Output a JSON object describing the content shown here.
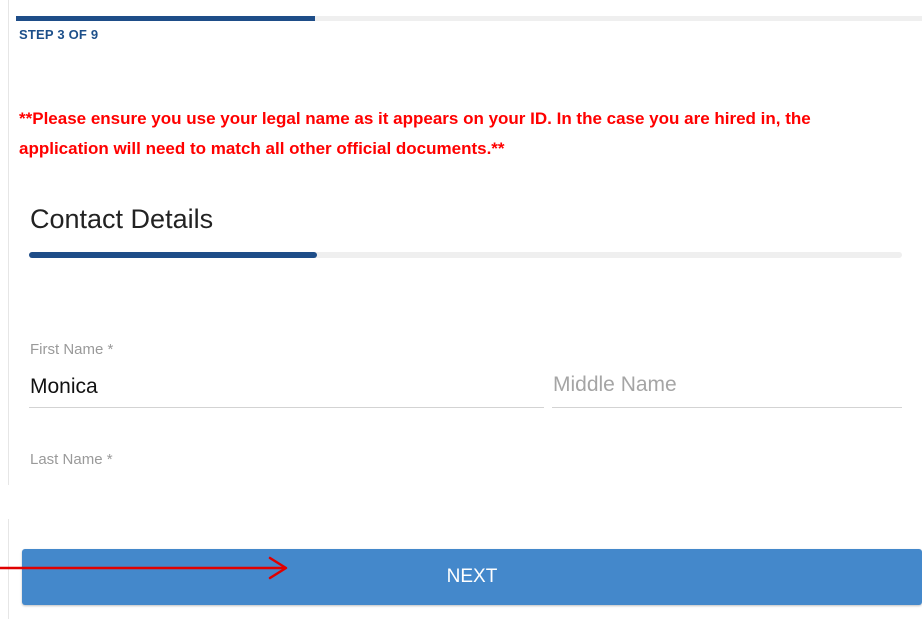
{
  "progress": {
    "step_label": "STEP 3 OF 9",
    "completed_fraction": 0.33,
    "section_fraction": 0.33
  },
  "notice": {
    "text": "**Please ensure you use your legal name as it appears on your ID. In the case you are hired in, the application will need to match all other official documents.**",
    "color": "#ff0000"
  },
  "section": {
    "title": "Contact Details"
  },
  "fields": {
    "first_name": {
      "label": "First Name *",
      "value": "Monica"
    },
    "middle_name": {
      "placeholder": "Middle Name",
      "value": ""
    },
    "last_name": {
      "label": "Last Name *"
    }
  },
  "actions": {
    "next_label": "NEXT"
  },
  "colors": {
    "accent": "#1e4d88",
    "button": "#4488cb",
    "annotation_arrow": "#e00000"
  },
  "annotation": {
    "icon": "arrow-right-icon"
  }
}
